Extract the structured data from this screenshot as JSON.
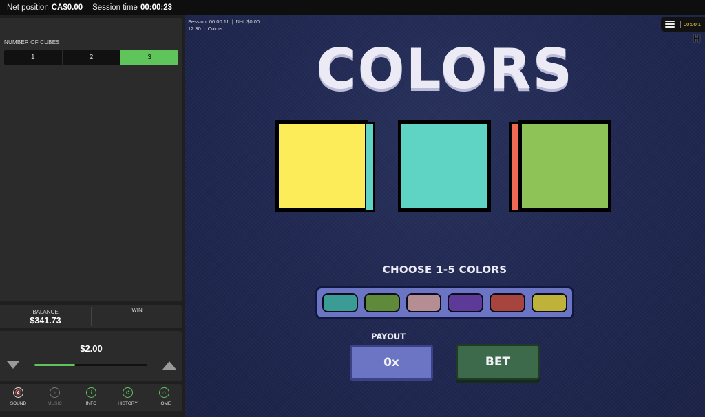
{
  "topbar": {
    "net_position_label": "Net position",
    "net_position_value": "CA$0.00",
    "session_time_label": "Session time",
    "session_time_value": "00:00:23"
  },
  "cubes": {
    "title": "NUMBER OF CUBES",
    "options": [
      "1",
      "2",
      "3"
    ],
    "selected": "3"
  },
  "balance": {
    "balance_label": "BALANCE",
    "balance_value": "$341.73",
    "win_label": "WIN",
    "win_value": ""
  },
  "bet": {
    "amount": "$2.00",
    "slider_level": 0.36
  },
  "nav": [
    {
      "label": "SOUND",
      "icon": "sound-off-icon"
    },
    {
      "label": "MUSIC",
      "icon": "music-off-icon"
    },
    {
      "label": "INFO",
      "icon": "info-icon"
    },
    {
      "label": "HISTORY",
      "icon": "history-icon"
    },
    {
      "label": "HOME",
      "icon": "home-icon"
    }
  ],
  "game": {
    "session_line1_a": "Session: 00:00:11",
    "session_line1_b": "Net:   $0.00",
    "session_line2_a": "12:30",
    "session_line2_b": "Colors",
    "menu_time": "00:00:1",
    "logo": "H",
    "title": "COLORS",
    "choose_label": "CHOOSE 1-5 COLORS",
    "payout_label": "PAYOUT",
    "payout_value": "0x",
    "bet_label": "BET",
    "cubes": [
      {
        "face": "#fcec5a",
        "side": "#5fd3c4",
        "side_pos": "right"
      },
      {
        "face": "#5fd3c4",
        "side": "",
        "side_pos": "none"
      },
      {
        "face": "#8ec457",
        "side": "#ef6a52",
        "side_pos": "left"
      }
    ],
    "palette_colors": [
      "#3a9c94",
      "#5e8a3a",
      "#b48e92",
      "#5d3a97",
      "#a8443e",
      "#bfb23a"
    ]
  },
  "colors": {
    "accent": "#5fc55a",
    "panel": "#2b2b2b",
    "game_bg": "#1f2750"
  }
}
